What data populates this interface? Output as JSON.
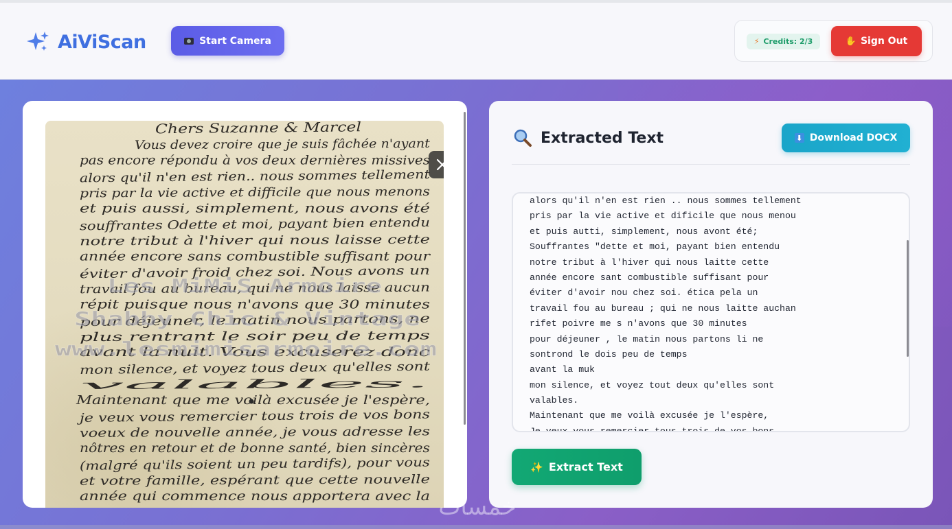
{
  "app": {
    "logo_text": "AiViScan",
    "accent": "#3f6fe0"
  },
  "header": {
    "camera_button_label": "Start Camera",
    "credits_text": "Credits: 2/3",
    "signout_label": "Sign Out"
  },
  "image_panel": {
    "letter_lines": [
      "Chers Suzanne & Marcel",
      "Vous devez croire que je suis fâchée n'ayant",
      "pas encore répondu à vos deux dernières missives",
      "alors qu'il n'en est rien.. nous sommes tellement",
      "pris par la vie active et difficile que nous menons",
      "et puis aussi, simplement, nous avons été",
      "souffrantes Odette et moi, payant bien entendu",
      "notre tribut à l'hiver qui nous laisse cette",
      "année encore sans combustible suffisant pour",
      "éviter d'avoir froid chez soi. Nous avons un",
      "travail fou au bureau, qui ne nous laisse aucun",
      "répit puisque nous n'avons que 30 minutes",
      "pour déjeuner, le matin nous partons, ne",
      "plus rentrant le soir peu de temps",
      "avant la nuit. Vous excuserez donc",
      "mon silence, et voyez tous deux qu'elles sont",
      "valables.",
      "Maintenant que me voilà excusée je l'espère,",
      "je veux vous remercier tous trois de vos bons",
      "voeux de nouvelle année, je vous adresse les",
      "nôtres en retour et de bonne santé, bien sincères",
      "(malgré qu'ils soient un peu tardifs), pour vous",
      "et votre famille, espérant que cette nouvelle",
      "année qui commence nous apportera avec la"
    ],
    "watermark_lines": [
      "Les MiMiS Armoire",
      "Shabby Chic & Vintage",
      "www.lesmimisarmoire.com"
    ]
  },
  "extract_panel": {
    "title": "Extracted Text",
    "download_label": "Download DOCX",
    "extract_label": "Extract Text",
    "lines": [
      "alors qu'il n'en est rien .. nous sommes tellement",
      "pris par la vie active et dificile que nous menou",
      "et puis autti, simplement, nous avont été;",
      "Souffrantes \"dette et moi, payant bien entendu",
      "notre tribut à l'hiver qui nous laitte cette",
      "année encore sant combustible suffisant pour",
      "éviter d'avoir nou chez soi. ética pela un",
      "travail fou au bureau ; qui ne nous laitte auchan",
      "rifet poivre me s n'avons que 30 minutes",
      "pour déjeuner , le matin nous partons li ne",
      "sontrond le dois peu de temps",
      "avant la muk",
      "mon silence, et voyez tout deux qu'elles sont",
      "valables.",
      "Maintenant que me voilà excusée je l'espère,",
      "Je veux vous remercier tous trois de vos bons"
    ]
  },
  "footer_watermark": "خمسات"
}
